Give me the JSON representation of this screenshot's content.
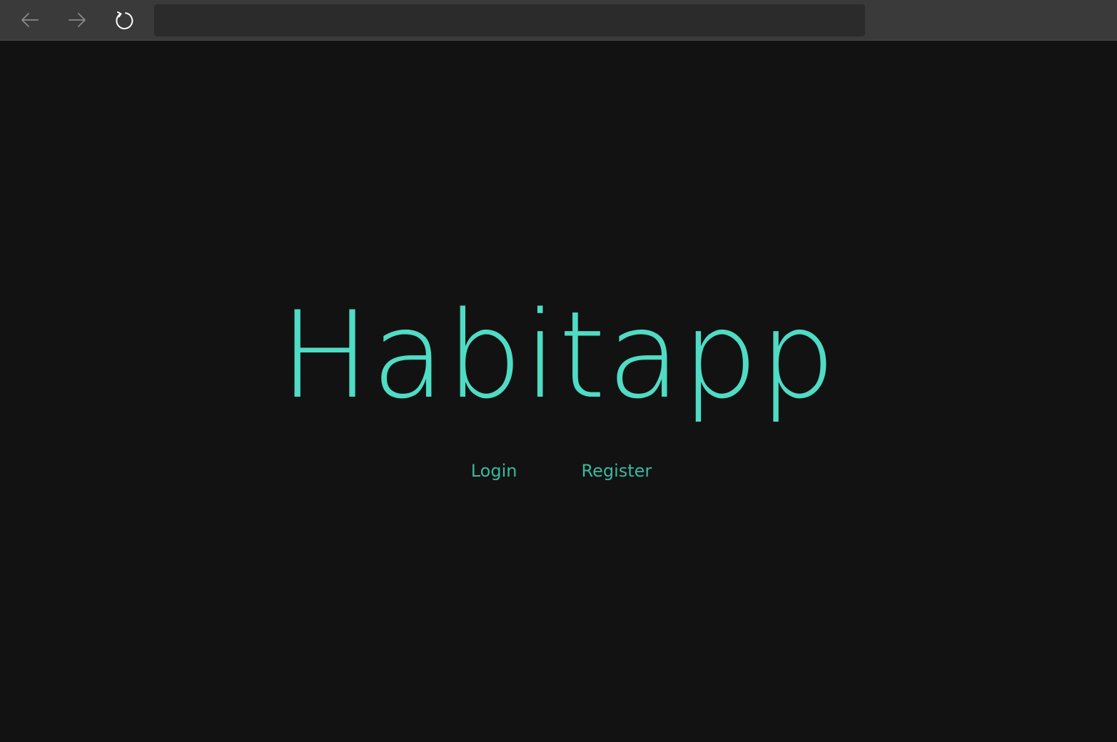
{
  "browser": {
    "address_value": "",
    "icons": {
      "back": "arrow-left-icon",
      "forward": "arrow-right-icon",
      "reload": "reload-icon"
    }
  },
  "main": {
    "title": "Habitapp",
    "links": {
      "login": "Login",
      "register": "Register"
    }
  },
  "colors": {
    "accent": "#4fdcc4",
    "link": "#3ab89f",
    "background": "#121212",
    "toolbar": "#3a3a3a"
  }
}
